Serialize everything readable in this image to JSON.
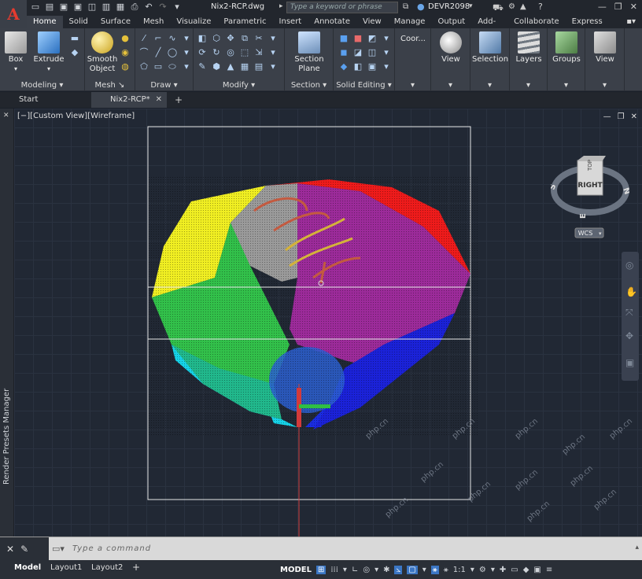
{
  "title_bar": {
    "doc_title": "Nix2-RCP.dwg",
    "search_placeholder": "Type a keyword or phrase",
    "user": "DEVR2098"
  },
  "ribbon_tabs": [
    "Home",
    "Solid",
    "Surface",
    "Mesh",
    "Visualize",
    "Parametric",
    "Insert",
    "Annotate",
    "View",
    "Manage",
    "Output",
    "Add-ins",
    "Collaborate",
    "Express Tools"
  ],
  "ribbon": {
    "box": "Box",
    "extrude": "Extrude",
    "smooth_object_1": "Smooth",
    "smooth_object_2": "Object",
    "section_plane_1": "Section",
    "section_plane_2": "Plane",
    "coordinates": "Coor...",
    "view_btn": "View",
    "selection": "Selection",
    "layers": "Layers",
    "groups": "Groups",
    "view_btn2": "View",
    "panels": {
      "modeling": "Modeling",
      "mesh": "Mesh",
      "draw": "Draw",
      "modify": "Modify",
      "section": "Section",
      "solid_editing": "Solid Editing"
    }
  },
  "doc_tabs": {
    "start": "Start",
    "active": "Nix2-RCP*"
  },
  "viewport": {
    "label": "[−][Custom View][Wireframe]"
  },
  "side_panel": {
    "label": "Render Presets Manager"
  },
  "viewcube": {
    "face": "RIGHT",
    "top": "TOP",
    "n": "N",
    "s": "S",
    "e": "E",
    "wcs": "WCS"
  },
  "command": {
    "placeholder": "Type a command"
  },
  "status": {
    "model_tab": "Model",
    "layout1": "Layout1",
    "layout2": "Layout2",
    "model": "MODEL",
    "scale": "1:1"
  },
  "watermark": "php.cn"
}
